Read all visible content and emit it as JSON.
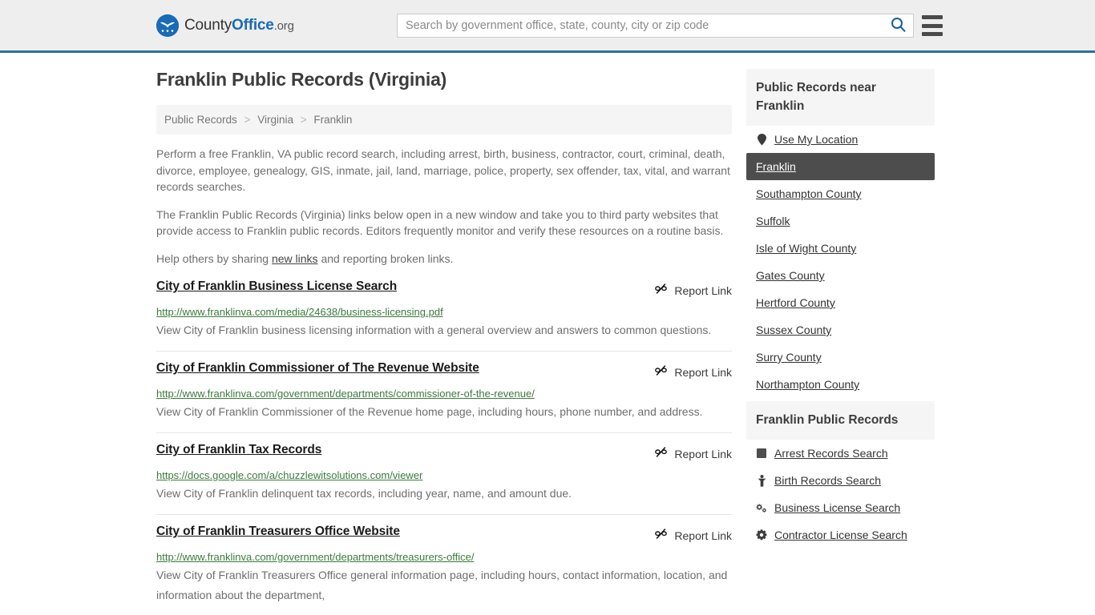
{
  "header": {
    "brand": {
      "part1": "County",
      "part2": "Office",
      "part3": ".org",
      "logo_icon": "eagle-shield-logo-icon"
    },
    "search": {
      "placeholder": "Search by government office, state, county, city or zip code",
      "value": "",
      "search_icon": "search-icon"
    },
    "menu_icon": "hamburger-menu-icon",
    "accent_color": "#2e6da4",
    "background_color": "#eeeeee"
  },
  "page": {
    "title": "Franklin Public Records (Virginia)"
  },
  "breadcrumb": {
    "items": [
      {
        "label": "Public Records",
        "current": false
      },
      {
        "label": "Virginia",
        "current": false
      },
      {
        "label": "Franklin",
        "current": true
      }
    ],
    "separator": ">"
  },
  "intro": {
    "p1": "Perform a free Franklin, VA public record search, including arrest, birth, business, contractor, court, criminal, death, divorce, employee, genealogy, GIS, inmate, jail, land, marriage, police, property, sex offender, tax, vital, and warrant records searches.",
    "p2": "The Franklin Public Records (Virginia) links below open in a new window and take you to third party websites that provide access to Franklin public records. Editors frequently monitor and verify these resources on a routine basis.",
    "p3_before": "Help others by sharing ",
    "p3_link": "new links",
    "p3_after": " and reporting broken links."
  },
  "results": {
    "report_label": "Report Link",
    "report_icon": "broken-link-icon",
    "items": [
      {
        "title": "City of Franklin Business License Search",
        "url": "http://www.franklinva.com/media/24638/business-licensing.pdf",
        "description": "View City of Franklin business licensing information with a general overview and answers to common questions."
      },
      {
        "title": "City of Franklin Commissioner of The Revenue Website",
        "url": "http://www.franklinva.com/government/departments/commissioner-of-the-revenue/",
        "description": "View City of Franklin Commissioner of the Revenue home page, including hours, phone number, and address."
      },
      {
        "title": "City of Franklin Tax Records",
        "url": "https://docs.google.com/a/chuzzlewitsolutions.com/viewer",
        "description": "View City of Franklin delinquent tax records, including year, name, and amount due."
      },
      {
        "title": "City of Franklin Treasurers Office Website",
        "url": "http://www.franklinva.com/government/departments/treasurers-office/",
        "description": "View City of Franklin Treasurers Office general information page, including hours, contact information, location, and information about the department,"
      }
    ]
  },
  "sidebar": {
    "nearby": {
      "heading": "Public Records near Franklin",
      "items": [
        {
          "label": "Use My Location",
          "icon": "map-pin-icon",
          "active": false
        },
        {
          "label": "Franklin",
          "icon": "",
          "active": true
        },
        {
          "label": "Southampton County",
          "icon": "",
          "active": false
        },
        {
          "label": "Suffolk",
          "icon": "",
          "active": false
        },
        {
          "label": "Isle of Wight County",
          "icon": "",
          "active": false
        },
        {
          "label": "Gates County",
          "icon": "",
          "active": false
        },
        {
          "label": "Hertford County",
          "icon": "",
          "active": false
        },
        {
          "label": "Sussex County",
          "icon": "",
          "active": false
        },
        {
          "label": "Surry County",
          "icon": "",
          "active": false
        },
        {
          "label": "Northampton County",
          "icon": "",
          "active": false
        }
      ],
      "active_background": "#4d4d4d"
    },
    "records": {
      "heading": "Franklin Public Records",
      "items": [
        {
          "label": "Arrest Records Search",
          "icon": "fingerprint-square-icon"
        },
        {
          "label": "Birth Records Search",
          "icon": "baby-icon"
        },
        {
          "label": "Business License Search",
          "icon": "cogs-icon"
        },
        {
          "label": "Contractor License Search",
          "icon": "gear-icon"
        }
      ]
    }
  }
}
